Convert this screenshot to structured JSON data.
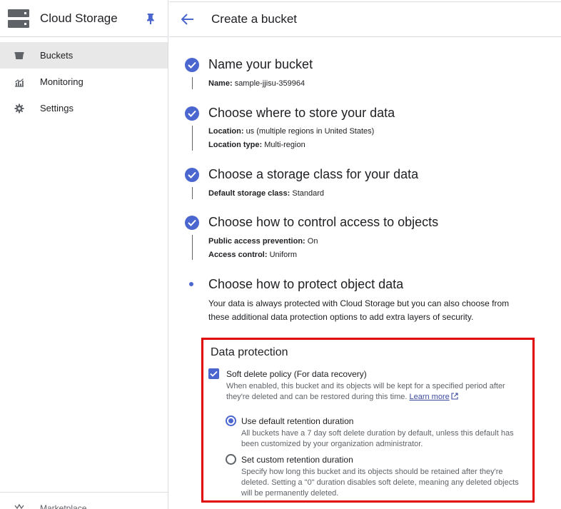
{
  "sidebar": {
    "app_title": "Cloud Storage",
    "items": [
      {
        "label": "Buckets",
        "icon": "bucket-icon",
        "active": true
      },
      {
        "label": "Monitoring",
        "icon": "chart-icon",
        "active": false
      },
      {
        "label": "Settings",
        "icon": "gear-icon",
        "active": false
      }
    ],
    "footer_label": "Marketplace"
  },
  "header": {
    "title": "Create a bucket"
  },
  "steps": [
    {
      "title": "Name your bucket",
      "details": [
        {
          "key": "Name:",
          "value": "sample-jjisu-359964"
        }
      ]
    },
    {
      "title": "Choose where to store your data",
      "details": [
        {
          "key": "Location:",
          "value": "us (multiple regions in United States)"
        },
        {
          "key": "Location type:",
          "value": "Multi-region"
        }
      ]
    },
    {
      "title": "Choose a storage class for your data",
      "details": [
        {
          "key": "Default storage class:",
          "value": "Standard"
        }
      ]
    },
    {
      "title": "Choose how to control access to objects",
      "details": [
        {
          "key": "Public access prevention:",
          "value": "On"
        },
        {
          "key": "Access control:",
          "value": "Uniform"
        }
      ]
    }
  ],
  "protect": {
    "title": "Choose how to protect object data",
    "description": "Your data is always protected with Cloud Storage but you can also choose from these additional data protection options to add extra layers of security.",
    "box_title": "Data protection",
    "soft_delete": {
      "label": "Soft delete policy (For data recovery)",
      "desc": "When enabled, this bucket and its objects will be kept for a specified period after they're deleted and can be restored during this time.",
      "link": "Learn more",
      "checked": true
    },
    "options": [
      {
        "label": "Use default retention duration",
        "desc": "All buckets have a 7 day soft delete duration by default, unless this default has been customized by your organization administrator.",
        "selected": true
      },
      {
        "label": "Set custom retention duration",
        "desc": "Specify how long this bucket and its objects should be retained after they're deleted. Setting a \"0\" duration disables soft delete, meaning any deleted objects will be permanently deleted.",
        "selected": false
      }
    ]
  },
  "colors": {
    "accent": "#4b67cf",
    "highlight_border": "#e00000",
    "nav_active": "#e8e8e8"
  }
}
